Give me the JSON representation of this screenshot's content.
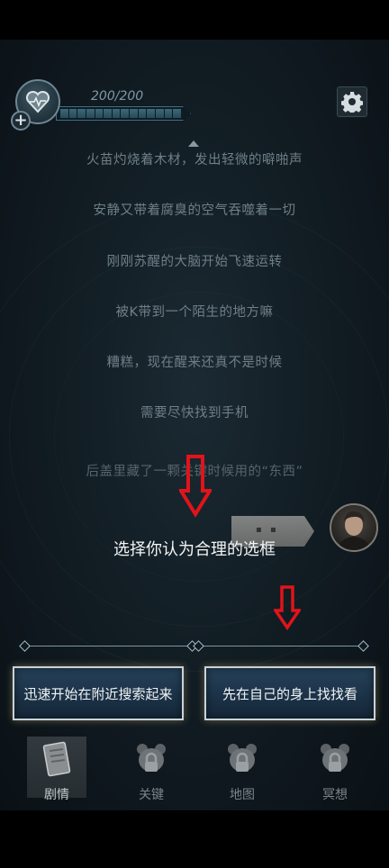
{
  "hud": {
    "hp_text": "200/200",
    "hp_fraction": 1.0,
    "heart_icon": "heart-icon",
    "plus_icon": "plus-icon",
    "settings_icon": "gear-icon"
  },
  "story_lines": [
    "火苗灼烧着木材，发出轻微的噼啪声",
    "安静又带着腐臭的空气吞噬着一切",
    "刚刚苏醒的大脑开始飞速运转",
    "被K带到一个陌生的地方嘛",
    "糟糕，现在醒来还真不是时候",
    "需要尽快找到手机",
    "后盖里藏了一颗关键时候用的“东西”"
  ],
  "prompt": "选择你认为合理的选框",
  "choices": [
    "迅速开始在附近搜索起来",
    "先在自己的身上找找看"
  ],
  "nav": [
    {
      "label": "剧情",
      "icon": "notebook-icon",
      "active": true
    },
    {
      "label": "关键",
      "icon": "locked-bear-icon",
      "active": false
    },
    {
      "label": "地图",
      "icon": "locked-bear-icon",
      "active": false
    },
    {
      "label": "冥想",
      "icon": "locked-bear-icon",
      "active": false
    }
  ],
  "colors": {
    "background": "#121d24",
    "arrow": "#e0141a",
    "choice_bg": "#1b3146",
    "text_primary": "#f3f5f6"
  }
}
